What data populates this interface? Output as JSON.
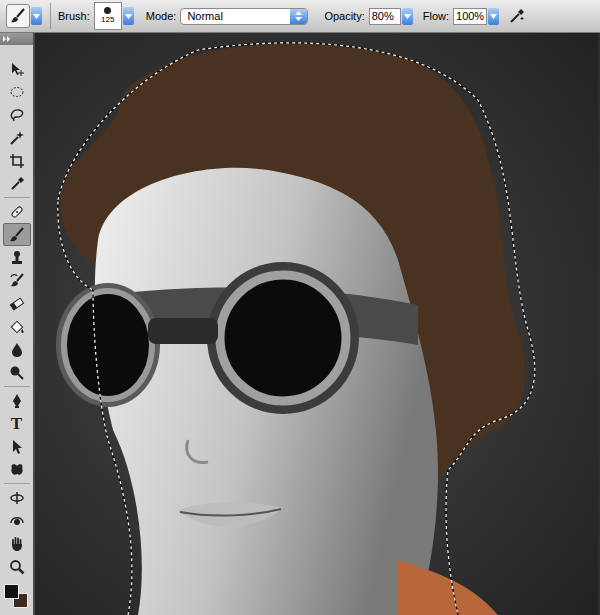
{
  "options_bar": {
    "brush_label": "Brush:",
    "brush_size": "125",
    "mode_label": "Mode:",
    "mode_value": "Normal",
    "opacity_label": "Opacity:",
    "opacity_value": "80%",
    "flow_label": "Flow:",
    "flow_value": "100%",
    "airbrush_enabled": false
  },
  "toolbar": {
    "tools": [
      {
        "kind": "move",
        "selected": false
      },
      {
        "kind": "marquee",
        "selected": false
      },
      {
        "kind": "lasso",
        "selected": false
      },
      {
        "kind": "wand",
        "selected": false
      },
      {
        "kind": "crop",
        "selected": false
      },
      {
        "kind": "eyedropper",
        "selected": false
      },
      {
        "kind": "healing",
        "selected": false
      },
      {
        "kind": "brush",
        "selected": true
      },
      {
        "kind": "stamp",
        "selected": false
      },
      {
        "kind": "history",
        "selected": false
      },
      {
        "kind": "eraser",
        "selected": false
      },
      {
        "kind": "bucket",
        "selected": false
      },
      {
        "kind": "blur",
        "selected": false
      },
      {
        "kind": "dodge",
        "selected": false
      },
      {
        "kind": "pen",
        "selected": false
      },
      {
        "kind": "type",
        "label": "T",
        "selected": false
      },
      {
        "kind": "pathselect",
        "selected": false
      },
      {
        "kind": "shape",
        "selected": false
      },
      {
        "kind": "rotate3d",
        "selected": false
      },
      {
        "kind": "orbit3d",
        "selected": false
      },
      {
        "kind": "hand",
        "selected": false
      },
      {
        "kind": "zoom",
        "selected": false
      }
    ],
    "swatches": [
      {
        "color": "#111111"
      },
      {
        "color": "#3d2a1c"
      }
    ]
  }
}
